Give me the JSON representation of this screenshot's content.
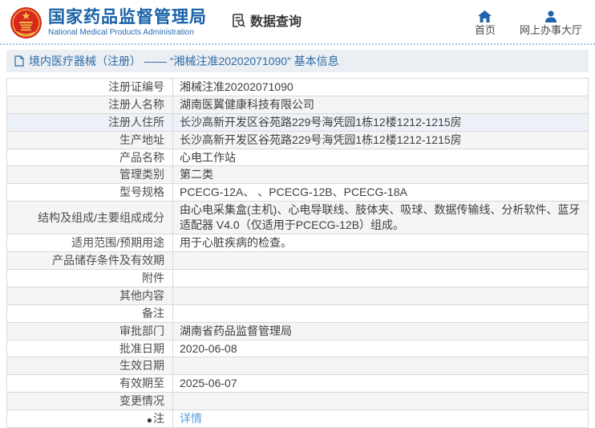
{
  "header": {
    "brand": {
      "title_cn": "国家药品监督管理局",
      "title_en": "National Medical Products Administration"
    },
    "data_query_label": "数据查询",
    "nav": [
      {
        "label": "首页",
        "icon": "home-icon"
      },
      {
        "label": "网上办事大厅",
        "icon": "person-icon"
      }
    ]
  },
  "title_bar": {
    "text": "境内医疗器械（注册） —— “湘械注准20202071090” 基本信息",
    "icon": "document-icon"
  },
  "table": {
    "rows": [
      {
        "label": "注册证编号",
        "value": "湘械注准20202071090"
      },
      {
        "label": "注册人名称",
        "value": "湖南医翼健康科技有限公司"
      },
      {
        "label": "注册人住所",
        "value": "长沙高新开发区谷苑路229号海凭园1栋12楼1212-1215房",
        "highlight": true
      },
      {
        "label": "生产地址",
        "value": "长沙高新开发区谷苑路229号海凭园1栋12楼1212-1215房"
      },
      {
        "label": "产品名称",
        "value": "心电工作站"
      },
      {
        "label": "管理类别",
        "value": "第二类"
      },
      {
        "label": "型号规格",
        "value": "PCECG-12A、 、PCECG-12B、PCECG-18A"
      },
      {
        "label": "结构及组成/主要组成成分",
        "value": "由心电采集盒(主机)、心电导联线、肢体夹、吸球、数据传输线、分析软件、蓝牙适配器 V4.0（仅适用于PCECG-12B）组成。",
        "tall": true
      },
      {
        "label": "适用范围/预期用途",
        "value": "用于心脏疾病的检查。"
      },
      {
        "label": "产品储存条件及有效期",
        "value": ""
      },
      {
        "label": "附件",
        "value": ""
      },
      {
        "label": "其他内容",
        "value": ""
      },
      {
        "label": "备注",
        "value": ""
      },
      {
        "label": "审批部门",
        "value": "湖南省药品监督管理局"
      },
      {
        "label": "批准日期",
        "value": "2020-06-08"
      },
      {
        "label": "生效日期",
        "value": ""
      },
      {
        "label": "有效期至",
        "value": "2025-06-07"
      },
      {
        "label": "变更情况",
        "value": ""
      },
      {
        "label": "注",
        "value": "详情",
        "is_link": true,
        "has_icon": true
      }
    ]
  },
  "colors": {
    "brand_blue": "#1a61a8",
    "nav_icon_blue": "#2163ac",
    "title_bar_bg": "#ebeef2",
    "title_bar_text": "#2e6ca8",
    "emblem_red": "#d6281e",
    "emblem_gold": "#f2c245",
    "table_border": "#d9d9d9",
    "stripe_gray": "#f5f5f5",
    "row_hover_blue": "#edf1f8",
    "link_blue": "#54a0dc",
    "dotted_divider": "#a9c6e2"
  }
}
